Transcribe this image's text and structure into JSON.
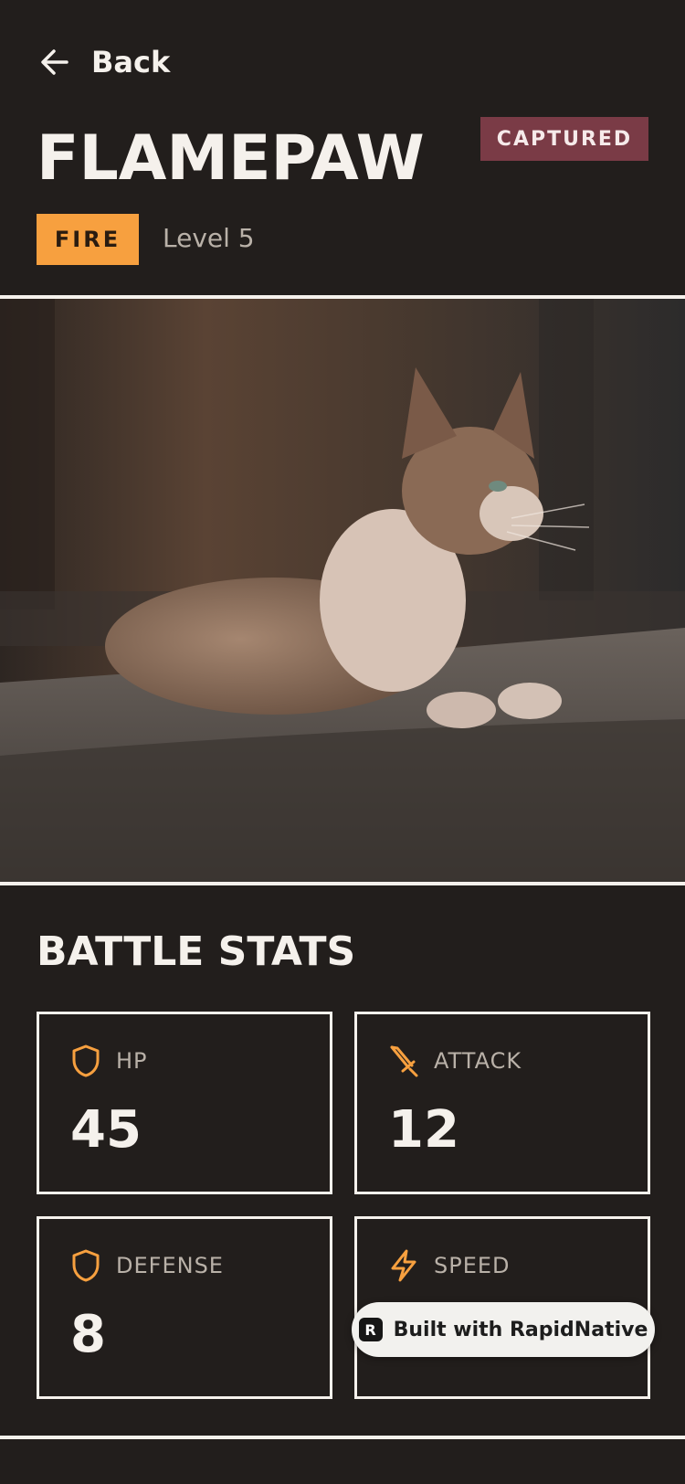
{
  "header": {
    "back_label": "Back",
    "title": "FLAMEPAW",
    "status_badge": "CAPTURED",
    "type_badge": "FIRE",
    "level": "Level 5"
  },
  "stats": {
    "title": "BATTLE STATS",
    "cards": [
      {
        "label": "HP",
        "value": "45",
        "icon": "shield-icon"
      },
      {
        "label": "ATTACK",
        "value": "12",
        "icon": "sword-icon"
      },
      {
        "label": "DEFENSE",
        "value": "8",
        "icon": "shield-icon"
      },
      {
        "label": "SPEED",
        "value": "",
        "icon": "lightning-icon"
      }
    ]
  },
  "builder_pill": {
    "label": "Built with RapidNative",
    "logo_letter": "R"
  },
  "colors": {
    "background": "#221e1c",
    "accent_orange": "#f7a03f",
    "captured_badge": "#7a3b46",
    "text_primary": "#f5f1ec",
    "text_muted": "#b9b1a8"
  }
}
